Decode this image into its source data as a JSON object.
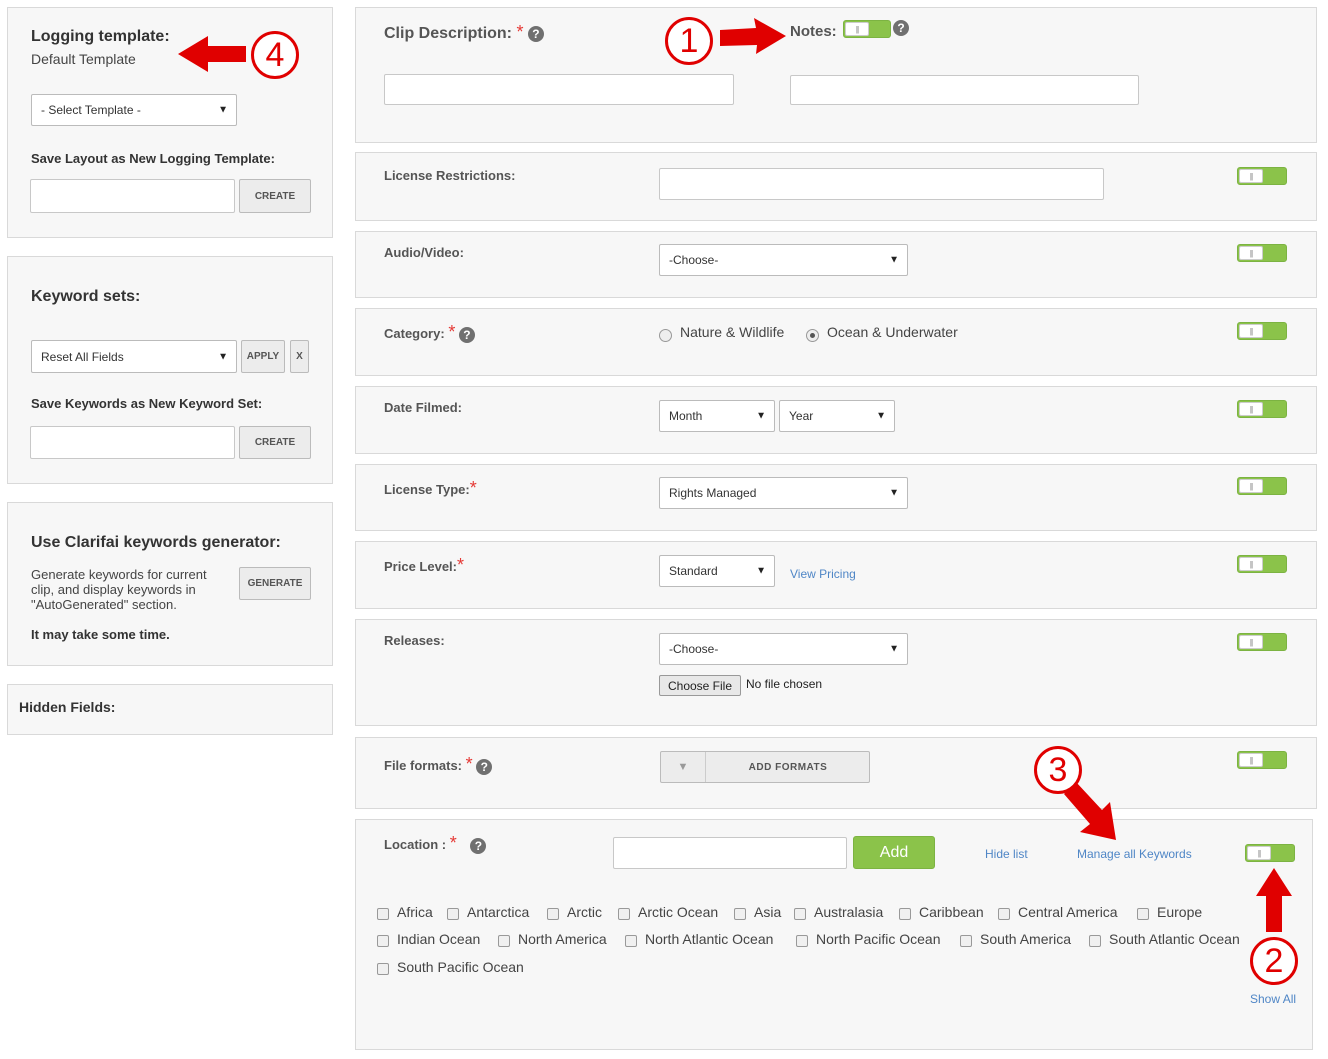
{
  "left": {
    "logging": {
      "title": "Logging template:",
      "current": "Default Template",
      "select_value": "- Select Template -",
      "save_label": "Save Layout as New Logging Template:",
      "create": "CREATE"
    },
    "keywords": {
      "title": "Keyword sets:",
      "select_value": "Reset All Fields",
      "apply": "APPLY",
      "clear": "X",
      "save_label": "Save Keywords as New Keyword Set:",
      "create": "CREATE"
    },
    "clarifai": {
      "title": "Use Clarifai keywords generator:",
      "desc_line1": "Generate keywords for current",
      "desc_line2": "clip, and display keywords in",
      "desc_line3": "\"AutoGenerated\" section.",
      "generate": "GENERATE",
      "note": "It may take some time."
    },
    "hidden": {
      "title": "Hidden Fields:"
    }
  },
  "form": {
    "clip_description": {
      "label": "Clip Description:",
      "required": "*",
      "help": "?"
    },
    "notes": {
      "label": "Notes:",
      "help": "?"
    },
    "license_restrictions": {
      "label": "License Restrictions:"
    },
    "audio_video": {
      "label": "Audio/Video:",
      "value": "-Choose-"
    },
    "category": {
      "label": "Category:",
      "required": "*",
      "help": "?",
      "options": [
        "Nature & Wildlife",
        "Ocean & Underwater"
      ],
      "selected": "Ocean & Underwater"
    },
    "date_filmed": {
      "label": "Date Filmed:",
      "month": "Month",
      "year": "Year"
    },
    "license_type": {
      "label": "License Type:",
      "required": "*",
      "value": "Rights Managed"
    },
    "price_level": {
      "label": "Price Level:",
      "required": "*",
      "value": "Standard",
      "link": "View Pricing"
    },
    "releases": {
      "label": "Releases:",
      "value": "-Choose-",
      "choose_file": "Choose File",
      "no_file": "No file chosen"
    },
    "file_formats": {
      "label": "File formats:",
      "required": "*",
      "help": "?",
      "button": "ADD FORMATS"
    },
    "location": {
      "label": "Location :",
      "required": "*",
      "help": "?",
      "add": "Add",
      "hide_list": "Hide list",
      "manage": "Manage all Keywords",
      "show_all": "Show All",
      "items": [
        "Africa",
        "Antarctica",
        "Arctic",
        "Arctic Ocean",
        "Asia",
        "Australasia",
        "Caribbean",
        "Central America",
        "Europe",
        "Indian Ocean",
        "North America",
        "North Atlantic Ocean",
        "North Pacific Ocean",
        "South America",
        "South Atlantic Ocean",
        "South Pacific Ocean"
      ]
    }
  },
  "annotations": {
    "n1": "1",
    "n2": "2",
    "n3": "3",
    "n4": "4"
  },
  "colors": {
    "toggle": "#8bc34a",
    "link": "#4f86c6",
    "required": "#e53935",
    "annotation": "#e00000"
  },
  "icons": [
    "help-icon",
    "caret-down-icon",
    "toggle-switch",
    "red-arrow"
  ]
}
